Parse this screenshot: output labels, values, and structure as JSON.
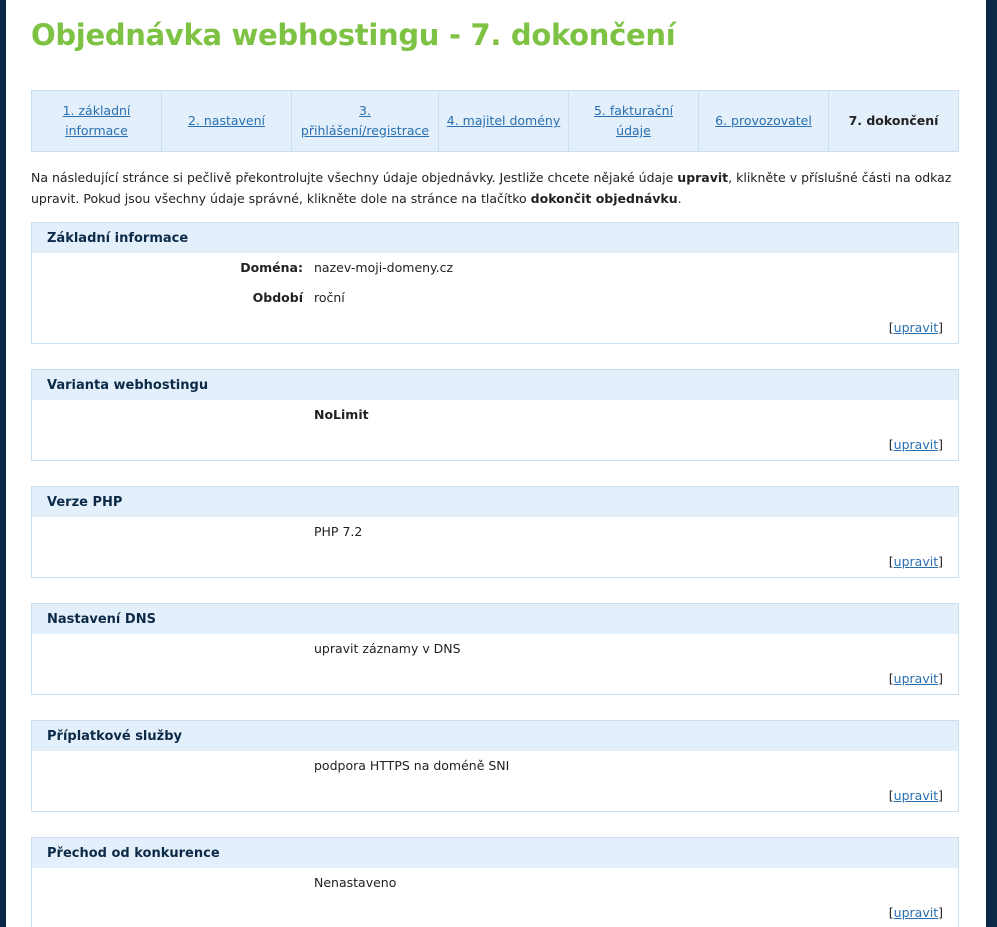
{
  "title": "Objednávka webhostingu - 7. dokončení",
  "steps": [
    {
      "label": "1. základní informace"
    },
    {
      "label": "2. nastavení"
    },
    {
      "label": "3. přihlášení/registrace"
    },
    {
      "label": "4. majitel domény"
    },
    {
      "label": "5. fakturační údaje"
    },
    {
      "label": "6. provozovatel"
    },
    {
      "label": "7. dokončení"
    }
  ],
  "intro": {
    "part1": "Na následující stránce si pečlivě překontrolujte všechny údaje objednávky. Jestliže chcete nějaké údaje ",
    "bold1": "upravit",
    "part2": ", klikněte v příslušné části na odkaz upravit. Pokud jsou všechny údaje správné, klikněte dole na stránce na tlačítko ",
    "bold2": "dokončit objednávku",
    "part3": "."
  },
  "edit": {
    "open": "[",
    "label": "upravit",
    "close": "]"
  },
  "sections": [
    {
      "title": "Základní informace",
      "rows": [
        {
          "label": "Doména:",
          "value": "nazev-moji-domeny.cz"
        },
        {
          "label": "Období",
          "value": "roční"
        }
      ]
    },
    {
      "title": "Varianta webhostingu",
      "rows": [
        {
          "label": "",
          "value": "NoLimit"
        }
      ]
    },
    {
      "title": "Verze PHP",
      "rows": [
        {
          "label": "",
          "value": "PHP 7.2"
        }
      ]
    },
    {
      "title": "Nastavení DNS",
      "rows": [
        {
          "label": "",
          "value": "upravit záznamy v DNS"
        }
      ]
    },
    {
      "title": "Příplatkové služby",
      "rows": [
        {
          "label": "",
          "value": "podpora HTTPS na doméně SNI"
        }
      ]
    },
    {
      "title": "Přechod od konkurence",
      "rows": [
        {
          "label": "",
          "value": "Nenastaveno"
        }
      ]
    }
  ]
}
